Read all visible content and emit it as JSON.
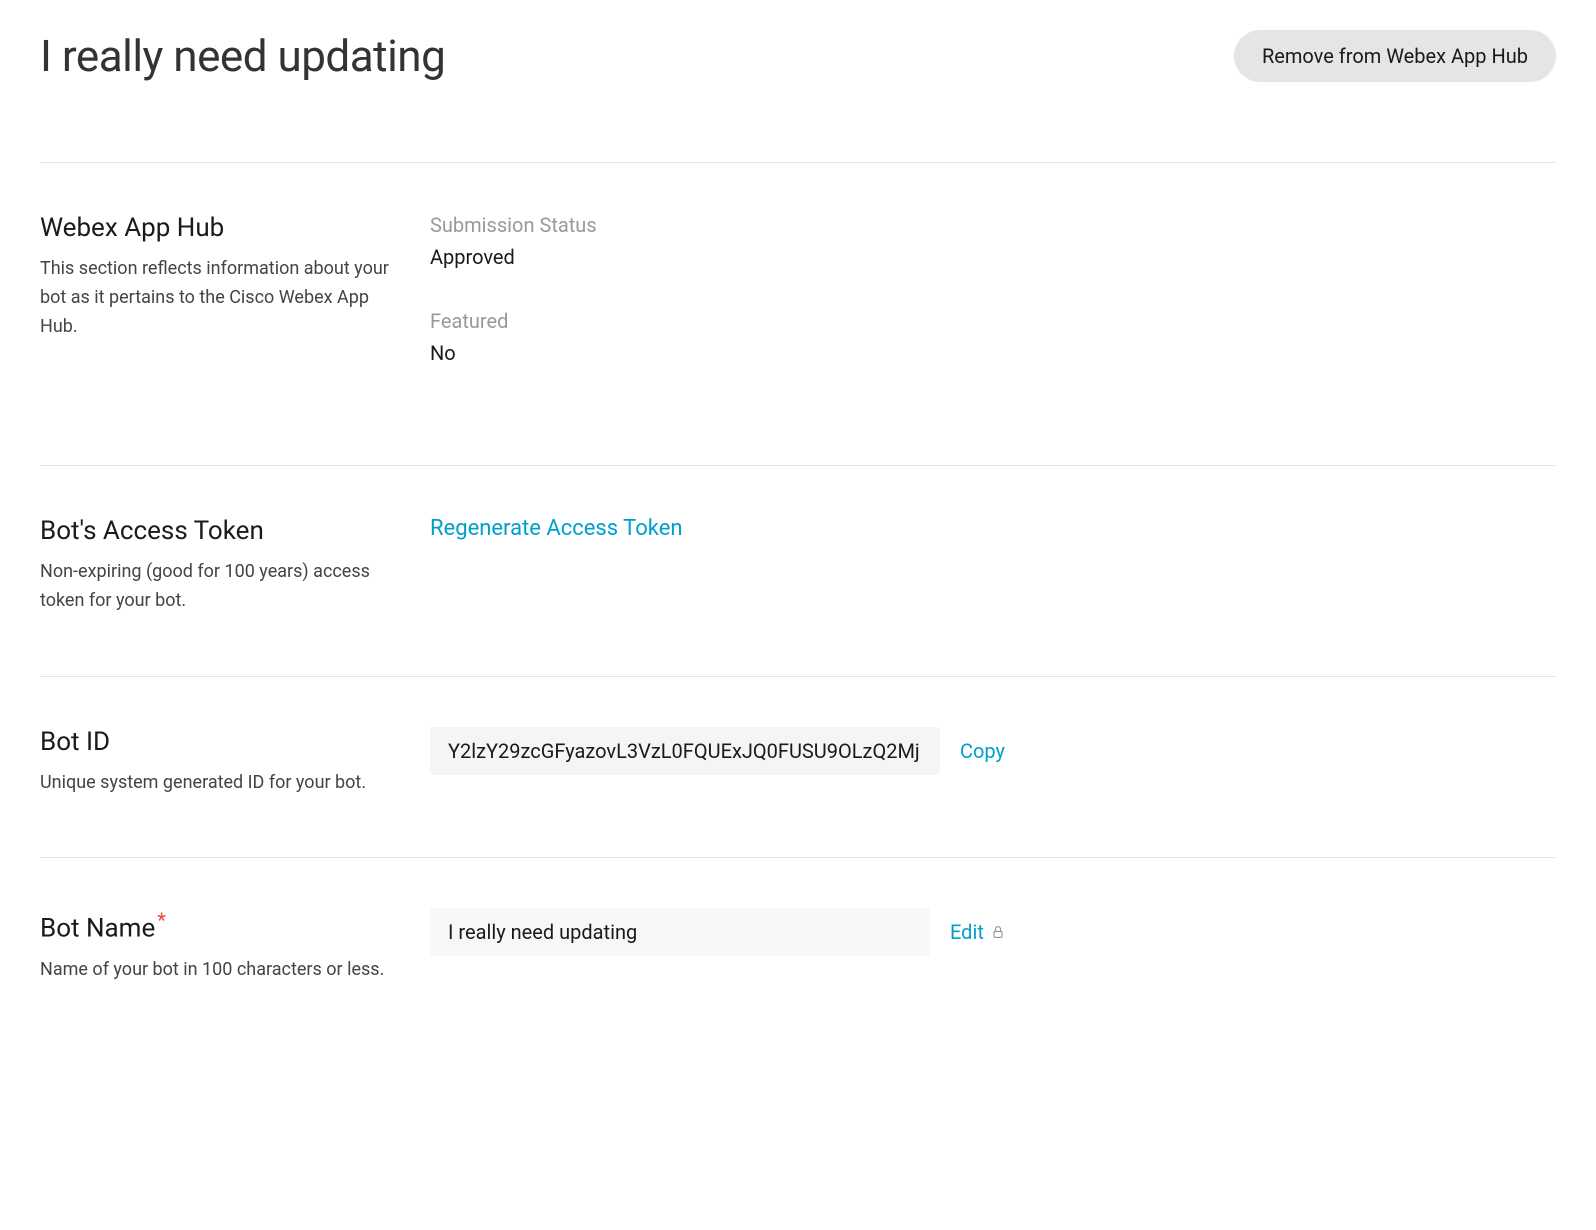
{
  "header": {
    "title": "I really need updating",
    "remove_button": "Remove from Webex App Hub"
  },
  "sections": {
    "app_hub": {
      "heading": "Webex App Hub",
      "description": "This section reflects information about your bot as it pertains to the Cisco Webex App Hub.",
      "submission_status_label": "Submission Status",
      "submission_status_value": "Approved",
      "featured_label": "Featured",
      "featured_value": "No"
    },
    "access_token": {
      "heading": "Bot's Access Token",
      "description": "Non-expiring (good for 100 years) access token for your bot.",
      "regenerate_link": "Regenerate Access Token"
    },
    "bot_id": {
      "heading": "Bot ID",
      "description": "Unique system generated ID for your bot.",
      "value": "Y2lzY29zcGFyazovL3VzL0FQUExJQ0FUSU9OLzQ2Mj",
      "copy_link": "Copy"
    },
    "bot_name": {
      "heading": "Bot Name",
      "description": "Name of your bot in 100 characters or less.",
      "value": "I really need updating",
      "edit_link": "Edit"
    }
  }
}
